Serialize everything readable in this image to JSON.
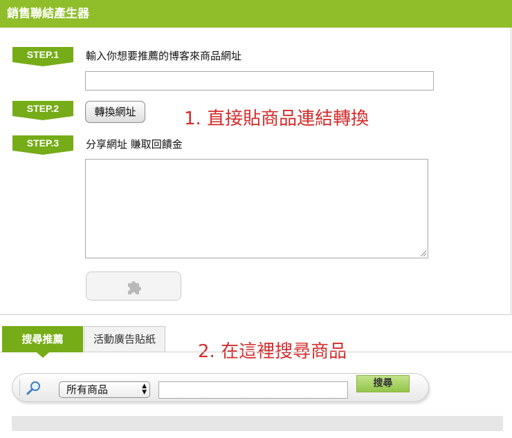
{
  "header": {
    "title": "銷售聯結產生器"
  },
  "steps": [
    {
      "badge": "STEP.1",
      "label": "輸入你想要推薦的博客來商品網址"
    },
    {
      "badge": "STEP.2",
      "button": "轉換網址"
    },
    {
      "badge": "STEP.3",
      "label": "分享網址 賺取回饋金"
    }
  ],
  "url_input": {
    "value": ""
  },
  "share_textarea": {
    "value": ""
  },
  "annotations": {
    "first": "1. 直接貼商品連結轉換",
    "second": "2. 在這裡搜尋商品"
  },
  "tabs": [
    {
      "label": "搜尋推薦",
      "active": true
    },
    {
      "label": "活動廣告貼紙",
      "active": false
    }
  ],
  "search": {
    "category_selected": "所有商品",
    "keyword_value": "",
    "button_label": "搜尋"
  },
  "colors": {
    "header_green": "#8fbe2a",
    "step_green": "#76ac17",
    "annotation_red": "#d42a2a"
  },
  "icons": {
    "plugin": "puzzle-piece-icon",
    "search": "magnifier-icon"
  }
}
